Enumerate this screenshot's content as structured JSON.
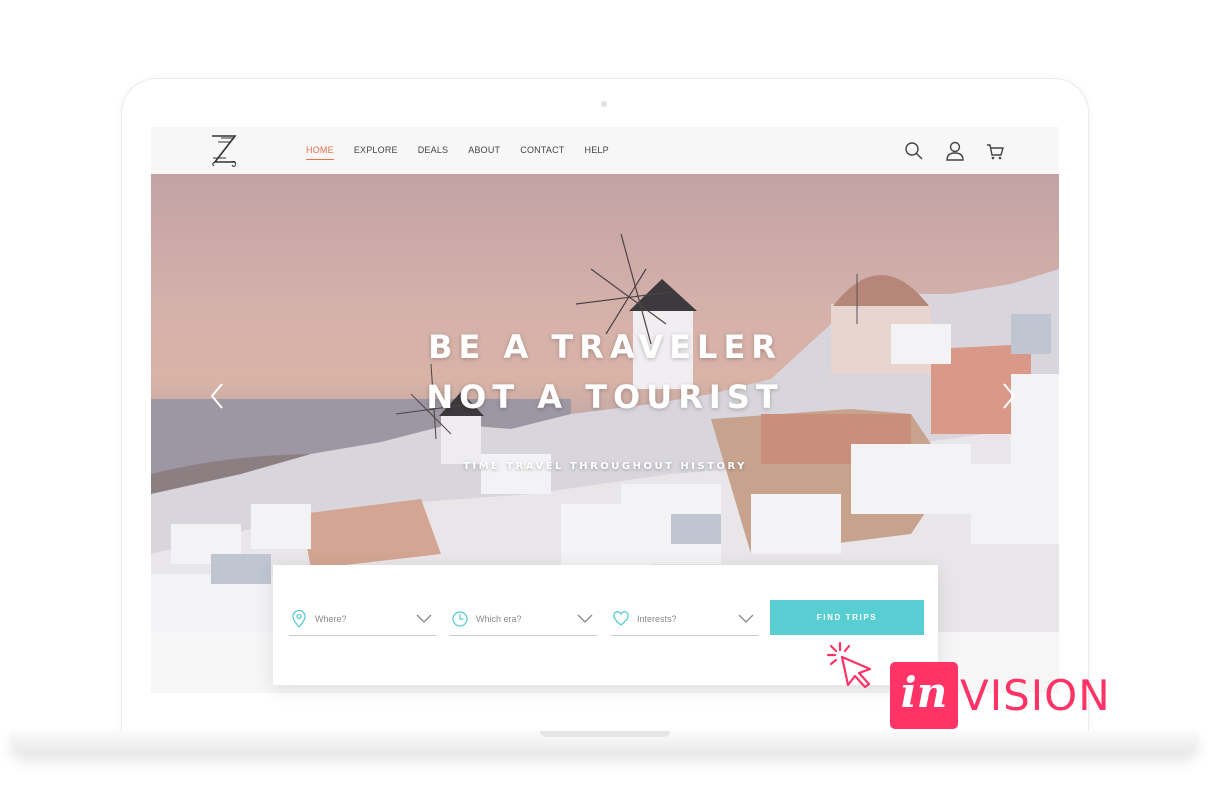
{
  "nav": {
    "items": [
      {
        "label": "HOME",
        "active": true
      },
      {
        "label": "EXPLORE",
        "active": false
      },
      {
        "label": "DEALS",
        "active": false
      },
      {
        "label": "ABOUT",
        "active": false
      },
      {
        "label": "CONTACT",
        "active": false
      },
      {
        "label": "HELP",
        "active": false
      }
    ],
    "icons": [
      "search-icon",
      "user-icon",
      "cart-icon"
    ]
  },
  "hero": {
    "title_line1": "BE A TRAVELER",
    "title_line2": "NOT A TOURIST",
    "subtitle": "TIME TRAVEL THROUGHOUT HISTORY"
  },
  "search": {
    "fields": [
      {
        "label": "Where?",
        "icon": "location-pin-icon"
      },
      {
        "label": "Which era?",
        "icon": "clock-icon"
      },
      {
        "label": "Interests?",
        "icon": "heart-icon"
      }
    ],
    "button_label": "FIND TRIPS"
  },
  "badge": {
    "box_text": "in",
    "text": "VISION"
  },
  "colors": {
    "accent_nav": "#e8724a",
    "button": "#58cdd2",
    "icon_teal": "#58cdd2",
    "brand_pink": "#ff3366"
  }
}
